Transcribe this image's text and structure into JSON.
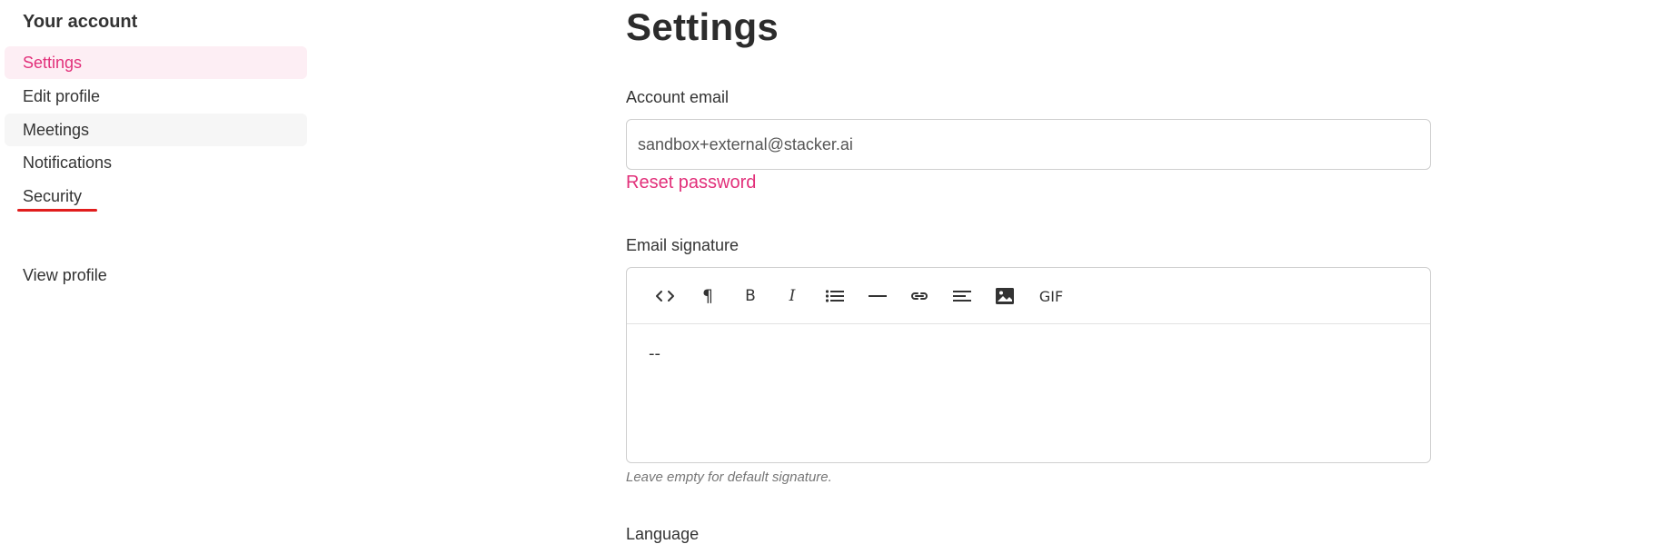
{
  "sidebar": {
    "heading": "Your account",
    "items": [
      {
        "label": "Settings",
        "state": "active"
      },
      {
        "label": "Edit profile",
        "state": "normal"
      },
      {
        "label": "Meetings",
        "state": "hover"
      },
      {
        "label": "Notifications",
        "state": "normal"
      },
      {
        "label": "Security",
        "state": "normal"
      }
    ],
    "view_profile": "View profile"
  },
  "main": {
    "title": "Settings",
    "account_email": {
      "label": "Account email",
      "value": "sandbox+external@stacker.ai"
    },
    "reset_password": "Reset password",
    "email_signature": {
      "label": "Email signature",
      "toolbar": [
        {
          "name": "code-icon",
          "glyph": "<>"
        },
        {
          "name": "paragraph-icon",
          "glyph": "¶"
        },
        {
          "name": "bold-icon",
          "glyph": "B"
        },
        {
          "name": "italic-icon",
          "glyph": "I"
        },
        {
          "name": "bullet-list-icon",
          "glyph": "list"
        },
        {
          "name": "horizontal-rule-icon",
          "glyph": "—"
        },
        {
          "name": "link-icon",
          "glyph": "link"
        },
        {
          "name": "align-icon",
          "glyph": "align"
        },
        {
          "name": "image-icon",
          "glyph": "image"
        },
        {
          "name": "gif-icon",
          "glyph": "GIF"
        }
      ],
      "content": "--",
      "hint": "Leave empty for default signature."
    },
    "language_label": "Language"
  },
  "colors": {
    "accent": "#e2307a",
    "active_bg": "#fdeef4",
    "hover_bg": "#f6f6f6",
    "annotation_underline": "#e11d1d"
  }
}
